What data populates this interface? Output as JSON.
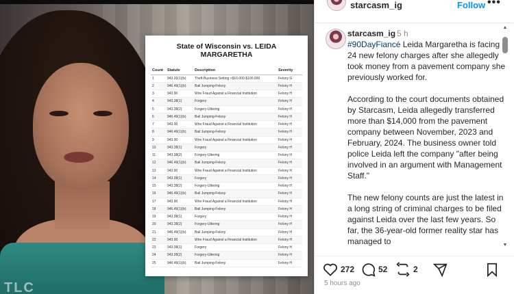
{
  "media": {
    "network_bug": "TLC"
  },
  "document": {
    "title": "State of Wisconsin vs. LEIDA MARGARETHA",
    "columns": [
      "Count",
      "Statute",
      "Description",
      "Severity"
    ],
    "rows": [
      [
        "1",
        "943.20(1)(b)",
        "Theft-Business Setting >$10,000-$100,000",
        "Felony G"
      ],
      [
        "2",
        "946.49(1)(b)",
        "Bail Jumping-Felony",
        "Felony H"
      ],
      [
        "3",
        "943.90",
        "Wire Fraud Against a Financial Institution",
        "Felony H"
      ],
      [
        "4",
        "943.38(1)",
        "Forgery",
        "Felony H"
      ],
      [
        "5",
        "943.38(2)",
        "Forgery-Uttering",
        "Felony H"
      ],
      [
        "6",
        "946.49(1)(b)",
        "Bail Jumping-Felony",
        "Felony H"
      ],
      [
        "7",
        "943.90",
        "Wire Fraud Against a Financial Institution",
        "Felony H"
      ],
      [
        "8",
        "946.49(1)(b)",
        "Bail Jumping-Felony",
        "Felony H"
      ],
      [
        "9",
        "943.90",
        "Wire Fraud Against a Financial Institution",
        "Felony H"
      ],
      [
        "10",
        "943.38(1)",
        "Forgery",
        "Felony H"
      ],
      [
        "11",
        "943.38(2)",
        "Forgery-Uttering",
        "Felony H"
      ],
      [
        "12",
        "946.49(1)(b)",
        "Bail Jumping-Felony",
        "Felony H"
      ],
      [
        "13",
        "943.90",
        "Wire Fraud Against a Financial Institution",
        "Felony H"
      ],
      [
        "14",
        "943.38(1)",
        "Forgery",
        "Felony H"
      ],
      [
        "15",
        "943.38(2)",
        "Forgery-Uttering",
        "Felony H"
      ],
      [
        "16",
        "946.49(1)(b)",
        "Bail Jumping-Felony",
        "Felony H"
      ],
      [
        "17",
        "943.90",
        "Wire Fraud Against a Financial Institution",
        "Felony H"
      ],
      [
        "18",
        "946.49(1)(b)",
        "Bail Jumping-Felony",
        "Felony H"
      ],
      [
        "19",
        "943.38(1)",
        "Forgery",
        "Felony H"
      ],
      [
        "20",
        "943.38(2)",
        "Forgery-Uttering",
        "Felony H"
      ],
      [
        "21",
        "946.49(1)(b)",
        "Bail Jumping-Felony",
        "Felony H"
      ],
      [
        "22",
        "943.90",
        "Wire Fraud Against a Financial Institution",
        "Felony H"
      ],
      [
        "23",
        "943.38(1)",
        "Forgery",
        "Felony H"
      ],
      [
        "24",
        "943.38(2)",
        "Forgery-Uttering",
        "Felony H"
      ],
      [
        "25",
        "946.49(1)(b)",
        "Bail Jumping-Felony",
        "Felony H"
      ]
    ]
  },
  "header": {
    "username": "starcasm_ig",
    "follow_label": "Follow",
    "more_label": "•••"
  },
  "caption": {
    "username": "starcasm_ig",
    "time": "5 h",
    "hashtag": "#90DayFiancé",
    "intro": " Leida Margaretha is facing 24 new felony charges after she allegedly took money from a pavement company she previously worked for.",
    "paragraph2": "According to the court documents obtained by Starcasm, Leida allegedly transferred more than $14,000 from the pavement company between November, 2023 and February, 2024. The business owner told police Leida left the company \"after being involved in an argument with Management Staff.\"",
    "paragraph3": "The new felony counts are just the latest in a long string of criminal charges to be filed against Leida over the last few years. So far, the 36-year-old former reality star has managed to"
  },
  "actions": {
    "likes": "272",
    "comments": "52",
    "reposts": "2"
  },
  "timestamp": "5 hours ago",
  "icons": {
    "like": "heart-icon",
    "comment": "comment-icon",
    "repost": "repost-icon",
    "share": "send-icon",
    "save": "bookmark-icon"
  }
}
